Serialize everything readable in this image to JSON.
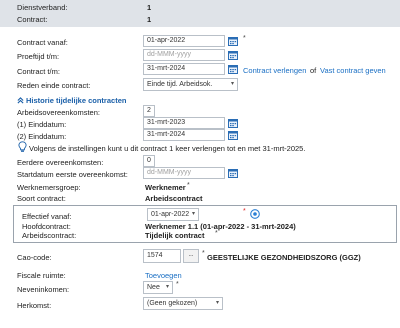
{
  "header": {
    "dienstverband_label": "Dienstverband:",
    "dienstverband_value": "1",
    "contract_label": "Contract:",
    "contract_value": "1"
  },
  "form": {
    "contract_vanaf_label": "Contract vanaf:",
    "contract_vanaf_value": "01-apr-2022",
    "contract_vanaf_req": "*",
    "proeftijd_label": "Proeftijd t/m:",
    "proeftijd_placeholder": "dd-MMM-yyyy",
    "contract_tm_label": "Contract t/m:",
    "contract_tm_value": "31-mrt-2024",
    "contract_verlengen_link": "Contract verlengen",
    "of_text": "of",
    "vast_contract_link": "Vast contract geven",
    "reden_label": "Reden einde contract:",
    "reden_value": "Einde tijd. Arbeidsok."
  },
  "historie": {
    "heading": "Historie tijdelijke contracten",
    "aantal_label": "Arbeidsovereenkomsten:",
    "aantal_value": "2",
    "einddatum1_label": "(1) Einddatum:",
    "einddatum1_value": "31-mrt-2023",
    "einddatum2_label": "(2) Einddatum:",
    "einddatum2_value": "31-mrt-2024",
    "info_text": "Volgens de instellingen kunt u dit contract 1 keer verlengen tot en met 31-mrt-2025.",
    "eerdere_label": "Eerdere overeenkomsten:",
    "eerdere_value": "0",
    "startdatum_label": "Startdatum eerste overeenkomst:",
    "startdatum_placeholder": "dd-MMM-yyyy"
  },
  "werknemer": {
    "groep_label": "Werknemersgroep:",
    "groep_value": "Werknemer",
    "groep_req": "*",
    "soort_label": "Soort contract:",
    "soort_value": "Arbeidscontract"
  },
  "effectief": {
    "label": "Effectief vanaf:",
    "select_value": "01-apr-2022",
    "req": "*",
    "hoofdcontract_label": "Hoofdcontract:",
    "hoofdcontract_value": "Werknemer 1.1 (01-apr-2022 - 31-mrt-2024)",
    "arbeidscontract_label": "Arbeidscontract:",
    "arbeidscontract_value": "Tijdelijk contract",
    "arbeidscontract_req": "*"
  },
  "cao": {
    "label": "Cao-code:",
    "value": "1574",
    "lookup_button": "...",
    "req": "*",
    "name": "GEESTELIJKE GEZONDHEIDSZORG (GGZ)"
  },
  "bottom": {
    "fiscale_label": "Fiscale ruimte:",
    "fiscale_link": "Toevoegen",
    "neveninkomen_label": "Neveninkomen:",
    "neveninkomen_value": "Nee",
    "neveninkomen_req": "*",
    "herkomst_label": "Herkomst:",
    "herkomst_value": "(Geen gekozen)"
  },
  "icons": {
    "calendar": "calendar-icon",
    "expand": "chevron-double-up-icon",
    "info": "lightbulb-icon",
    "add": "plus-circle-icon",
    "dropdown": "chevron-down-icon"
  },
  "colors": {
    "link": "#1a6fc4",
    "header_band": "#dfe3e8",
    "required_red": "#d22222"
  }
}
